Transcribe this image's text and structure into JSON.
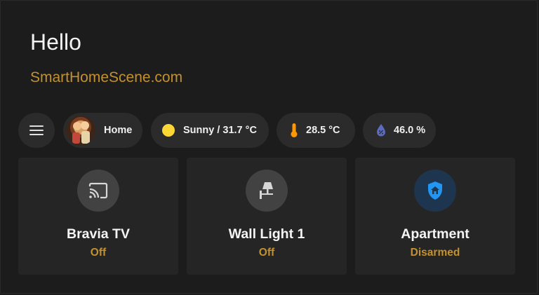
{
  "header": {
    "greeting": "Hello",
    "subtitle": "SmartHomeScene.com"
  },
  "chips": {
    "menu": {
      "icon": "menu-icon"
    },
    "home": {
      "icon": "avatar",
      "label": "Home"
    },
    "weather": {
      "icon": "sun-icon",
      "label": "Sunny / 31.7 °C"
    },
    "temperature": {
      "icon": "thermometer-icon",
      "label": "28.5 °C"
    },
    "humidity": {
      "icon": "water-drop-icon",
      "label": "46.0 %"
    }
  },
  "cards": [
    {
      "icon": "cast-icon",
      "title": "Bravia TV",
      "state": "Off"
    },
    {
      "icon": "wall-light-icon",
      "title": "Wall Light 1",
      "state": "Off"
    },
    {
      "icon": "shield-home-icon",
      "title": "Apartment",
      "state": "Disarmed"
    }
  ],
  "colors": {
    "background": "#1c1c1c",
    "card": "#252525",
    "chip": "#2b2b2b",
    "accent": "#c3912f",
    "sun": "#fdd835",
    "thermometer": "#ff9800",
    "humidity": "#5c6bc0",
    "alarm_icon": "#2196f3"
  }
}
